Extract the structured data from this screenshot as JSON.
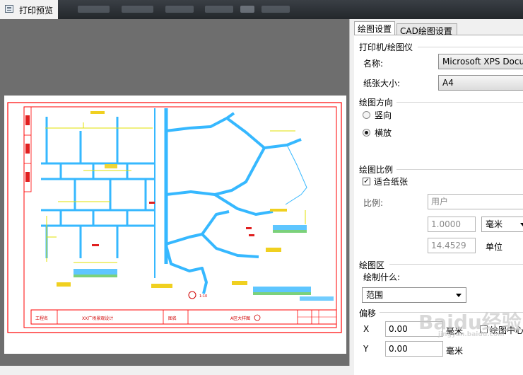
{
  "window": {
    "title": "打印预览"
  },
  "tabs": [
    {
      "label": "绘图设置",
      "active": true
    },
    {
      "label": "CAD绘图设置",
      "active": false
    }
  ],
  "printer": {
    "group": "打印机/绘图仪",
    "name_label": "名称:",
    "name_value": "Microsoft XPS Docu",
    "paper_label": "纸张大小:",
    "paper_value": "A4"
  },
  "orientation": {
    "group": "绘图方向",
    "portrait": "竖向",
    "landscape": "横放",
    "selected": "landscape"
  },
  "scale": {
    "group": "绘图比例",
    "fit_label": "适合纸张",
    "fit_checked": true,
    "ratio_label": "比例:",
    "ratio_value": "用户",
    "value1": "1.0000",
    "unit1": "毫米",
    "value2": "14.4529",
    "unit2": "单位"
  },
  "plot_area": {
    "group": "绘图区",
    "what_label": "绘制什么:",
    "what_value": "范围"
  },
  "offset": {
    "group": "偏移",
    "x_label": "X",
    "x_value": "0.00",
    "x_unit": "毫米",
    "center_label": "绘图中心",
    "y_label": "Y",
    "y_value": "0.00",
    "y_unit": "毫米"
  },
  "drawing": {
    "title_block": [
      "工程名",
      "XX广场景观设计",
      "图名",
      "A区大样图",
      "1:10"
    ]
  },
  "watermark": {
    "text": "Baidu经验",
    "sub": "jingyan.baidu.com"
  },
  "colors": {
    "cad_line": "#36b8ff",
    "frame": "#ff0000",
    "dim": "#e0e000"
  }
}
